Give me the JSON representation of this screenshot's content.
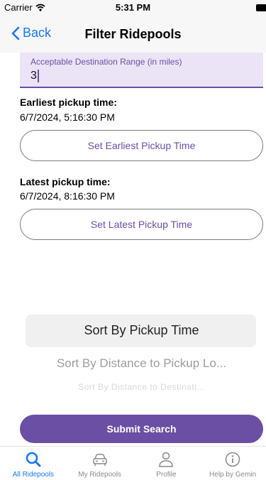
{
  "status_bar": {
    "carrier": "Carrier",
    "time": "5:31 PM"
  },
  "nav": {
    "back_label": "Back",
    "title": "Filter Ridepools"
  },
  "range_field": {
    "label": "Acceptable Destination Range (in miles)",
    "value": "3"
  },
  "earliest": {
    "label": "Earliest pickup time:",
    "value": "6/7/2024, 5:16:30 PM",
    "button": "Set Earliest Pickup Time"
  },
  "latest": {
    "label": "Latest pickup time:",
    "value": "6/7/2024, 8:16:30 PM",
    "button": "Set Latest Pickup Time"
  },
  "sort_picker": {
    "options": [
      "Sort By Pickup Time",
      "Sort By Distance to Pickup Lo...",
      "Sort By Distance to Destinati..."
    ],
    "selected": "Sort By Pickup Time"
  },
  "submit_label": "Submit Search",
  "tabs": [
    {
      "label": "All Ridepools",
      "icon": "search-icon",
      "active": true
    },
    {
      "label": "My Ridepools",
      "icon": "car-icon",
      "active": false
    },
    {
      "label": "Profile",
      "icon": "person-icon",
      "active": false
    },
    {
      "label": "Help by Gemin",
      "icon": "info-icon",
      "active": false
    }
  ],
  "colors": {
    "accent": "#6a4fa4",
    "link_blue": "#1777f0",
    "field_bg": "#ebe4f6"
  }
}
